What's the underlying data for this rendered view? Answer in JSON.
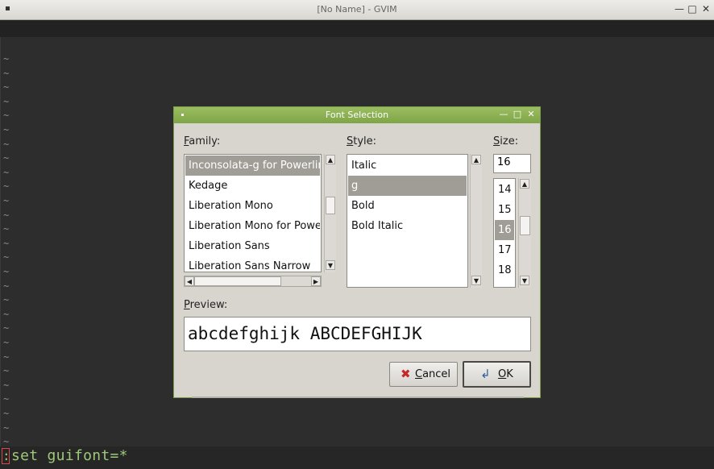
{
  "window": {
    "title": "[No Name] - GVIM",
    "tilde": "~"
  },
  "cmdline": {
    "colon": ":",
    "text": "set guifont=*"
  },
  "dialog": {
    "title": "Font Selection",
    "family_label": "amily:",
    "family_label_mnemonic": "F",
    "style_label": "tyle:",
    "style_label_mnemonic": "S",
    "size_label": "ize:",
    "size_label_prefix": "S",
    "size_label_mnemonic": "S",
    "family_items": [
      "Inconsolata-g for Powerline",
      "Kedage",
      "Liberation Mono",
      "Liberation Mono for Powerline",
      "Liberation Sans",
      "Liberation Sans Narrow"
    ],
    "style_items": [
      "Italic",
      "g",
      "Bold",
      "Bold Italic"
    ],
    "size_value": "16",
    "size_items": [
      "14",
      "15",
      "16",
      "17",
      "18"
    ],
    "preview_label": "review:",
    "preview_label_mnemonic": "P",
    "preview_text": "abcdefghijk ABCDEFGHIJK",
    "cancel_label": "ancel",
    "cancel_mnemonic": "C",
    "ok_label": "K",
    "ok_mnemonic": "O"
  },
  "colors": {
    "dialog_title": "#8bb052",
    "cmd_text": "#9ec97a",
    "selection": "#a09d96"
  }
}
